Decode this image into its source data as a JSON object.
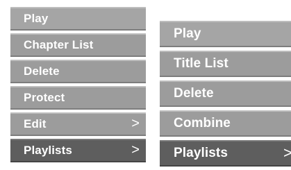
{
  "menus": {
    "left": {
      "items": [
        {
          "label": "Play",
          "chevron": ""
        },
        {
          "label": "Chapter List",
          "chevron": ""
        },
        {
          "label": "Delete",
          "chevron": ""
        },
        {
          "label": "Protect",
          "chevron": ""
        },
        {
          "label": "Edit",
          "chevron": ">"
        },
        {
          "label": "Playlists",
          "chevron": ">"
        }
      ]
    },
    "right": {
      "items": [
        {
          "label": "Play",
          "chevron": ""
        },
        {
          "label": "Title List",
          "chevron": ""
        },
        {
          "label": "Delete",
          "chevron": ""
        },
        {
          "label": "Combine",
          "chevron": ""
        },
        {
          "label": "Playlists",
          "chevron": ">"
        }
      ]
    }
  },
  "colors": {
    "item_bg": "#9c9c9c",
    "selected_bg": "#5e5e5e",
    "text": "#ffffff"
  },
  "selected": {
    "left": "Playlists",
    "right": "Playlists"
  }
}
